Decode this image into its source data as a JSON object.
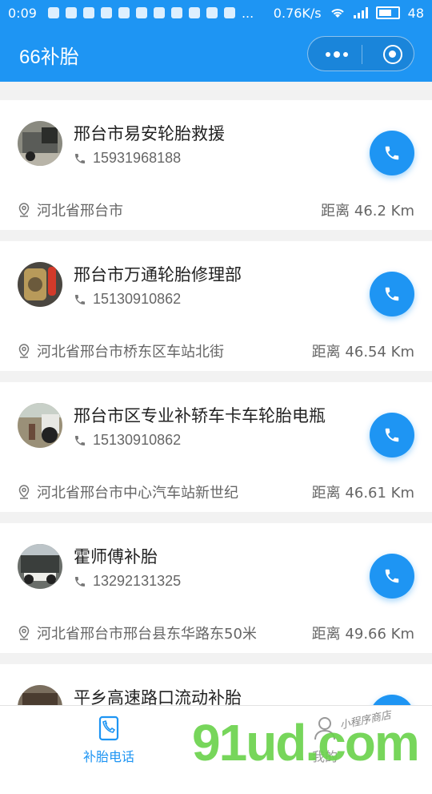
{
  "status_bar": {
    "time": "0:09",
    "net_speed": "0.76K/s",
    "battery": "48",
    "more": "..."
  },
  "header": {
    "title": "66补胎"
  },
  "colors": {
    "primary": "#1e95f3"
  },
  "listings": [
    {
      "name": "邢台市易安轮胎救援",
      "phone": "15931968188",
      "address": "河北省邢台市",
      "distance": "距离 46.2 Km"
    },
    {
      "name": "邢台市万通轮胎修理部",
      "phone": "15130910862",
      "address": "河北省邢台市桥东区车站北街",
      "distance": "距离 46.54 Km"
    },
    {
      "name": "邢台市区专业补轿车卡车轮胎电瓶",
      "phone": "15130910862",
      "address": "河北省邢台市中心汽车站新世纪",
      "distance": "距离 46.61 Km"
    },
    {
      "name": "霍师傅补胎",
      "phone": "13292131325",
      "address": "河北省邢台市邢台县东华路东50米",
      "distance": "距离 49.66 Km"
    },
    {
      "name": "平乡高速路口流动补胎",
      "phone": "",
      "address": "",
      "distance": ""
    }
  ],
  "tabbar": {
    "tab1_label": "补胎电话",
    "tab2_label": "我的"
  },
  "watermark": {
    "brand": "91ud.com",
    "tagline": "小程序商店"
  }
}
